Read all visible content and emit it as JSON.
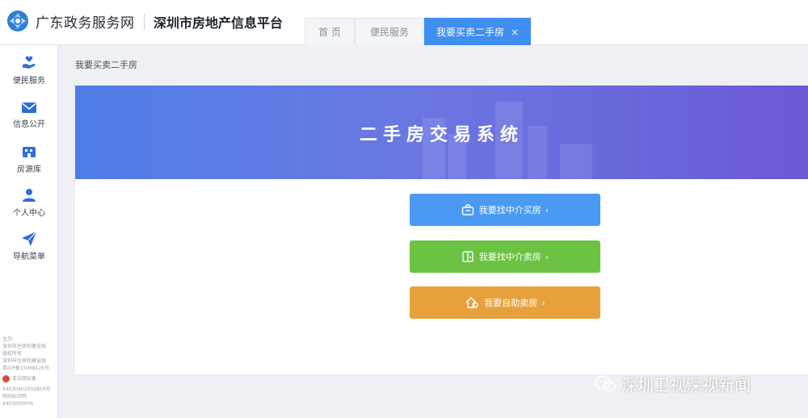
{
  "header": {
    "site_name": "广东政务服务网",
    "platform_name": "深圳市房地产信息平台",
    "tabs": [
      {
        "label": "首 页",
        "active": false
      },
      {
        "label": "便民服务",
        "active": false
      },
      {
        "label": "我要买卖二手房",
        "active": true,
        "close": "×"
      }
    ]
  },
  "sidebar": {
    "items": [
      {
        "label": "便民服务",
        "icon": "hand-heart-icon"
      },
      {
        "label": "信息公开",
        "icon": "envelope-icon"
      },
      {
        "label": "房源库",
        "icon": "building-icon"
      },
      {
        "label": "个人中心",
        "icon": "user-icon"
      },
      {
        "label": "导航菜单",
        "icon": "paper-plane-icon"
      }
    ],
    "footer_lines": [
      "主办:",
      "深圳市住房和建设局",
      "版权所有",
      "深圳市住房和建设局",
      "粤ICP备15068125号"
    ],
    "footer_badge": "单位网安备",
    "footer_lines_bottom": [
      "44030402002850号",
      "网站标识码",
      "4403000006"
    ]
  },
  "main": {
    "breadcrumb": "我要买卖二手房",
    "banner_title": "二手房交易系统",
    "actions": [
      {
        "label": "我要找中介买房",
        "chevron": "›",
        "color": "#4a9af3"
      },
      {
        "label": "我要找中介卖房",
        "chevron": "›",
        "color": "#6cc243"
      },
      {
        "label": "我要自助卖房",
        "chevron": "›",
        "color": "#e6a13c"
      }
    ]
  },
  "watermark": {
    "text": "深圳卫视深视新闻"
  },
  "colors": {
    "accent": "#3f8ff0",
    "banner_start": "#4f7de6",
    "banner_end": "#6b59d4"
  }
}
